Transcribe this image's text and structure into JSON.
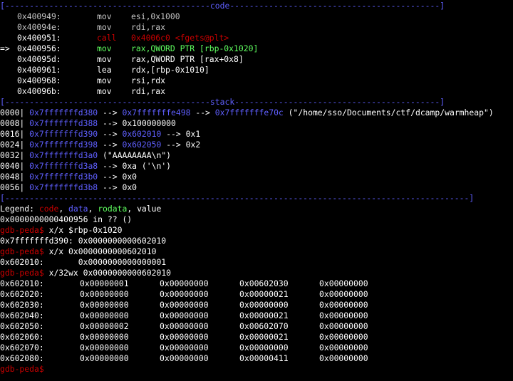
{
  "colors": {
    "background": "#000000",
    "separator": "#5f5fff",
    "code": "#cc0000",
    "current": "#5fff5f",
    "pointer": "#5f5fff",
    "text": "#ffffff",
    "dim": "#c8c8c8"
  },
  "sections": {
    "code_separator": "[------------------------------------------code-------------------------------------------]",
    "stack_separator": "[------------------------------------------stack------------------------------------------]",
    "end_separator": "[-----------------------------------------------------------------------------------------------]"
  },
  "code_lines": [
    {
      "prefix": "",
      "addr": "0x400949:",
      "op": "mov",
      "args": "esi,0x1000",
      "style": "dim"
    },
    {
      "prefix": "",
      "addr": "0x40094e:",
      "op": "mov",
      "args": "rdi,rax",
      "style": "dim"
    },
    {
      "prefix": "",
      "addr": "0x400951:",
      "op": "call",
      "args": "0x4006c0 <fgets@plt>",
      "style": "red"
    },
    {
      "prefix": "=>",
      "addr": "0x400956:",
      "op": "mov",
      "args": "rax,QWORD PTR [rbp-0x1020]",
      "style": "green"
    },
    {
      "prefix": "",
      "addr": "0x40095d:",
      "op": "mov",
      "args": "rax,QWORD PTR [rax+0x8]",
      "style": "white"
    },
    {
      "prefix": "",
      "addr": "0x400961:",
      "op": "lea",
      "args": "rdx,[rbp-0x1010]",
      "style": "white"
    },
    {
      "prefix": "",
      "addr": "0x400968:",
      "op": "mov",
      "args": "rsi,rdx",
      "style": "white"
    },
    {
      "prefix": "",
      "addr": "0x40096b:",
      "op": "mov",
      "args": "rdi,rax",
      "style": "white"
    }
  ],
  "stack_lines": [
    {
      "offset": "0000|",
      "addr": "0x7fffffffd380",
      "chain": [
        {
          "t": " --> ",
          "c": "white"
        },
        {
          "t": "0x7fffffffe498",
          "c": "blue"
        },
        {
          "t": " --> ",
          "c": "white"
        },
        {
          "t": "0x7fffffffe70c",
          "c": "blue"
        },
        {
          "t": " (\"/home/sso/Documents/ctf/dcamp/warmheap\")",
          "c": "white"
        }
      ]
    },
    {
      "offset": "0008|",
      "addr": "0x7fffffffd388",
      "chain": [
        {
          "t": " --> 0x100000000",
          "c": "white"
        }
      ]
    },
    {
      "offset": "0016|",
      "addr": "0x7fffffffd390",
      "chain": [
        {
          "t": " --> ",
          "c": "white"
        },
        {
          "t": "0x602010",
          "c": "blue"
        },
        {
          "t": " --> 0x1",
          "c": "white"
        }
      ]
    },
    {
      "offset": "0024|",
      "addr": "0x7fffffffd398",
      "chain": [
        {
          "t": " --> ",
          "c": "white"
        },
        {
          "t": "0x602050",
          "c": "blue"
        },
        {
          "t": " --> 0x2",
          "c": "white"
        }
      ]
    },
    {
      "offset": "0032|",
      "addr": "0x7fffffffd3a0",
      "chain": [
        {
          "t": " (\"AAAAAAAA\\n\")",
          "c": "white"
        }
      ]
    },
    {
      "offset": "0040|",
      "addr": "0x7fffffffd3a8",
      "chain": [
        {
          "t": " --> 0xa ('\\n')",
          "c": "white"
        }
      ]
    },
    {
      "offset": "0048|",
      "addr": "0x7fffffffd3b0",
      "chain": [
        {
          "t": " --> 0x0",
          "c": "white"
        }
      ]
    },
    {
      "offset": "0056|",
      "addr": "0x7fffffffd3b8",
      "chain": [
        {
          "t": " --> 0x0",
          "c": "white"
        }
      ]
    }
  ],
  "legend": {
    "label": "Legend: ",
    "code": "code",
    "data": "data",
    "rodata": "rodata",
    "value": "value",
    "sep": ", "
  },
  "status_line": "0x0000000000400956 in ?? ()",
  "prompt": "gdb-peda$",
  "commands": [
    {
      "cmd": " x/x $rbp-0x1020",
      "output": [
        "0x7fffffffd390: 0x0000000000602010"
      ]
    },
    {
      "cmd": " x/x 0x0000000000602010",
      "output": [
        "0x602010:       0x0000000000000001"
      ]
    },
    {
      "cmd": " x/32wx 0x0000000000602010",
      "output": []
    }
  ],
  "hexdump": [
    {
      "addr": "0x602010:",
      "vals": [
        "0x00000001",
        "0x00000000",
        "0x00602030",
        "0x00000000"
      ]
    },
    {
      "addr": "0x602020:",
      "vals": [
        "0x00000000",
        "0x00000000",
        "0x00000021",
        "0x00000000"
      ]
    },
    {
      "addr": "0x602030:",
      "vals": [
        "0x00000000",
        "0x00000000",
        "0x00000000",
        "0x00000000"
      ]
    },
    {
      "addr": "0x602040:",
      "vals": [
        "0x00000000",
        "0x00000000",
        "0x00000021",
        "0x00000000"
      ]
    },
    {
      "addr": "0x602050:",
      "vals": [
        "0x00000002",
        "0x00000000",
        "0x00602070",
        "0x00000000"
      ]
    },
    {
      "addr": "0x602060:",
      "vals": [
        "0x00000000",
        "0x00000000",
        "0x00000021",
        "0x00000000"
      ]
    },
    {
      "addr": "0x602070:",
      "vals": [
        "0x00000000",
        "0x00000000",
        "0x00000000",
        "0x00000000"
      ]
    },
    {
      "addr": "0x602080:",
      "vals": [
        "0x00000000",
        "0x00000000",
        "0x00000411",
        "0x00000000"
      ]
    }
  ],
  "final_prompt": "gdb-peda$"
}
